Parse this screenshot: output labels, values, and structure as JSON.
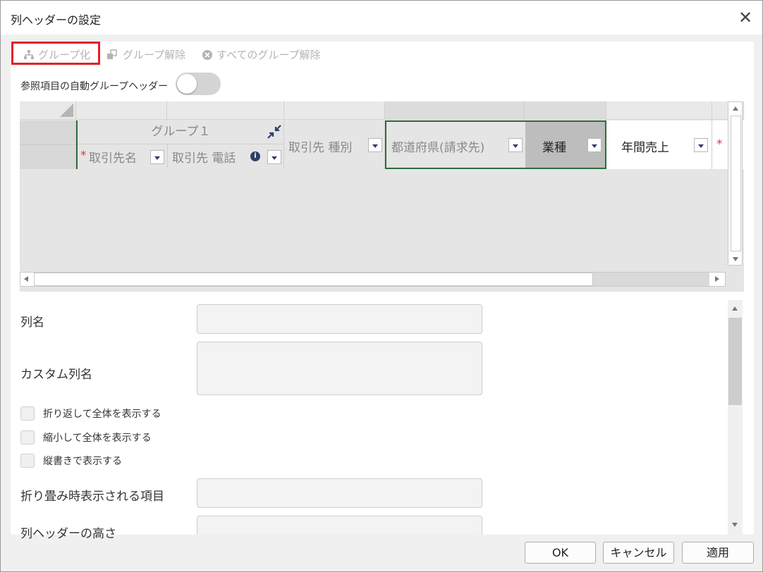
{
  "dialog": {
    "title": "列ヘッダーの設定",
    "close_glyph": "✕"
  },
  "toolbar": {
    "group": "グループ化",
    "ungroup": "グループ解除",
    "ungroup_all": "すべてのグループ解除"
  },
  "auto_group": {
    "label": "参照項目の自動グループヘッダー",
    "on": false
  },
  "grid": {
    "group_title": "グループ１",
    "columns": {
      "c1": "取引先名",
      "c2": "取引先 電話",
      "c3": "取引先 種別",
      "c4": "都道府県(請求先)",
      "c5": "業種",
      "c6": "年間売上"
    },
    "required_mark": "*",
    "info_glyph": "i"
  },
  "form": {
    "column_name": {
      "label": "列名",
      "value": ""
    },
    "custom_name": {
      "label": "カスタム列名",
      "value": ""
    },
    "checkboxes": [
      "折り返して全体を表示する",
      "縮小して全体を表示する",
      "縦書きで表示する"
    ],
    "collapsed_item": {
      "label": "折り畳み時表示される項目",
      "value": ""
    },
    "header_height": {
      "label": "列ヘッダーの高さ",
      "value": ""
    }
  },
  "buttons": {
    "ok": "OK",
    "cancel": "キャンセル",
    "apply": "適用"
  },
  "colors": {
    "highlight": "#e21f2b",
    "selection": "#2d6e3a",
    "required": "#e03a3a"
  }
}
